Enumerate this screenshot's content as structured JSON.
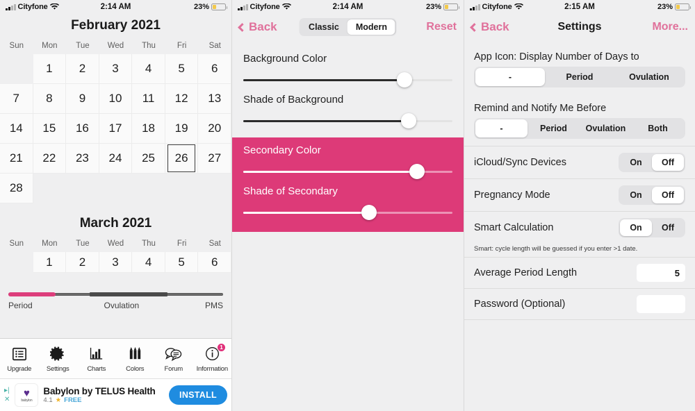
{
  "status_bar": {
    "carrier": "Cityfone",
    "time_left": "2:14 AM",
    "time_right": "2:15 AM",
    "battery": "23%",
    "battery_color": "#f2c94c"
  },
  "theme": {
    "accent_pink": "#dd3a78",
    "link_pink": "#e0719b",
    "page_bg": "#efeff0"
  },
  "panel_calendar": {
    "month_1": {
      "title": "February 2021",
      "dow": [
        "Sun",
        "Mon",
        "Tue",
        "Wed",
        "Thu",
        "Fri",
        "Sat"
      ],
      "weeks": [
        [
          "",
          "1",
          "2",
          "3",
          "4",
          "5",
          "6"
        ],
        [
          "7",
          "8",
          "9",
          "10",
          "11",
          "12",
          "13"
        ],
        [
          "14",
          "15",
          "16",
          "17",
          "18",
          "19",
          "20"
        ],
        [
          "21",
          "22",
          "23",
          "24",
          "25",
          "26",
          "27"
        ],
        [
          "28",
          "",
          "",
          "",
          "",
          "",
          ""
        ]
      ],
      "selected_day": "26"
    },
    "month_2": {
      "title": "March 2021",
      "dow": [
        "Sun",
        "Mon",
        "Tue",
        "Wed",
        "Thu",
        "Fri",
        "Sat"
      ],
      "weeks": [
        [
          "",
          "1",
          "2",
          "3",
          "4",
          "5",
          "6"
        ]
      ]
    },
    "phase_bar": {
      "period": "Period",
      "ovulation": "Ovulation",
      "pms": "PMS"
    },
    "tabs": [
      {
        "label": "Upgrade",
        "icon": "list-icon",
        "badge": ""
      },
      {
        "label": "Settings",
        "icon": "gear-icon",
        "badge": ""
      },
      {
        "label": "Charts",
        "icon": "bar-chart-icon",
        "badge": ""
      },
      {
        "label": "Colors",
        "icon": "pencils-icon",
        "badge": ""
      },
      {
        "label": "Forum",
        "icon": "chat-bubbles-icon",
        "badge": ""
      },
      {
        "label": "Information",
        "icon": "info-circle-icon",
        "badge": "1"
      }
    ],
    "ad": {
      "title": "Babylon by TELUS Health",
      "rating": "4.1",
      "price": "FREE",
      "cta": "INSTALL",
      "logo_caption": "babylon"
    }
  },
  "panel_colors": {
    "nav": {
      "back": "Back",
      "reset": "Reset",
      "segments": [
        "Classic",
        "Modern"
      ],
      "selected_segment": "Modern"
    },
    "sliders": [
      {
        "label": "Background Color",
        "value_pct": 77
      },
      {
        "label": "Shade of Background",
        "value_pct": 79
      },
      {
        "label": "Secondary Color",
        "value_pct": 83
      },
      {
        "label": "Shade of Secondary",
        "value_pct": 60
      }
    ]
  },
  "panel_settings": {
    "nav": {
      "back": "Back",
      "title": "Settings",
      "more": "More..."
    },
    "app_icon": {
      "heading": "App Icon: Display Number of Days to",
      "options": [
        "-",
        "Period",
        "Ovulation"
      ],
      "selected": "-"
    },
    "remind": {
      "heading": "Remind and Notify Me Before",
      "options": [
        "-",
        "Period",
        "Ovulation",
        "Both"
      ],
      "selected": "-"
    },
    "rows": [
      {
        "label": "iCloud/Sync Devices",
        "options": [
          "On",
          "Off"
        ],
        "selected": "Off"
      },
      {
        "label": "Pregnancy Mode",
        "options": [
          "On",
          "Off"
        ],
        "selected": "Off"
      },
      {
        "label": "Smart Calculation",
        "options": [
          "On",
          "Off"
        ],
        "selected": "On"
      }
    ],
    "hint": "Smart: cycle length will be guessed if you enter >1 date.",
    "fields": [
      {
        "label": "Average Period Length",
        "value": "5"
      },
      {
        "label": "Password (Optional)",
        "value": ""
      }
    ]
  }
}
